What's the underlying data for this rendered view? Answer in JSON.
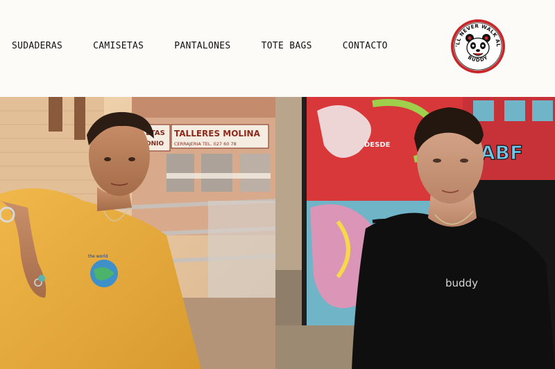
{
  "nav": {
    "items": [
      {
        "label": "SUDADERAS"
      },
      {
        "label": "CAMISETAS"
      },
      {
        "label": "PANTALONES"
      },
      {
        "label": "TOTE BAGS"
      },
      {
        "label": "CONTACTO"
      }
    ]
  },
  "logo": {
    "arc_text_top": "YOU'LL NEVER WALK ALONE",
    "arc_text_bottom": "BUDDY",
    "icon": "panda-face-icon"
  },
  "hero": {
    "left_photo": {
      "sign_text": "TALLERES MOLINA",
      "sign_subtext": "CERRAJERIA TEL. 027 60 78",
      "sign_left_text": "ETAS",
      "sign_left_sub": "ONIO",
      "shirt_color": "#e9ad3d"
    },
    "right_photo": {
      "shirt_print": "buddy",
      "shirt_color": "#111111",
      "graffiti_text": "DESDE",
      "graffiti_text2": "ABF"
    }
  }
}
